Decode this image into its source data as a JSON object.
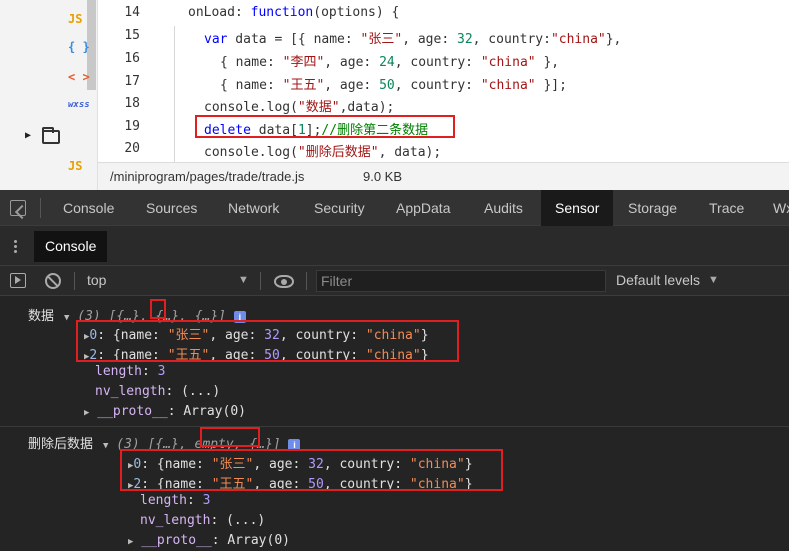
{
  "file_tree": {
    "items": [
      {
        "badge": "JS"
      },
      {
        "badge": "{ }"
      },
      {
        "badge": "< >"
      },
      {
        "badge": "wxss"
      },
      {
        "badge": "folder"
      },
      {
        "badge": "JS"
      }
    ]
  },
  "editor": {
    "line_numbers": [
      "14",
      "15",
      "16",
      "17",
      "18",
      "19",
      "20"
    ],
    "lines": {
      "l14": {
        "a": "onLoad: ",
        "b": "function",
        "c": "(options) {"
      },
      "l15": {
        "a": "var",
        "b": " data = [{ name: ",
        "c": "\"张三\"",
        "d": ", age: ",
        "e": "32",
        "f": ", country:",
        "g": "\"china\"",
        "h": "},"
      },
      "l16": {
        "a": "{ name: ",
        "b": "\"李四\"",
        "c": ", age: ",
        "d": "24",
        "e": ", country: ",
        "f": "\"china\"",
        "g": " },"
      },
      "l17": {
        "a": "{ name: ",
        "b": "\"王五\"",
        "c": ", age: ",
        "d": "50",
        "e": ", country: ",
        "f": "\"china\"",
        "g": " }];"
      },
      "l18": {
        "a": "console.log(",
        "b": "\"数据\"",
        "c": ",data);"
      },
      "l19": {
        "a": "delete",
        "b": " data[",
        "c": "1",
        "d": "];",
        "e": "//删除第二条数据"
      },
      "l20": {
        "a": "console.log(",
        "b": "\"删除后数据\"",
        "c": ", data);"
      }
    },
    "status_path": "/miniprogram/pages/trade/trade.js",
    "status_size": "9.0 KB"
  },
  "devtools": {
    "tabs": [
      "Console",
      "Sources",
      "Network",
      "Security",
      "AppData",
      "Audits",
      "Sensor",
      "Storage",
      "Trace",
      "Wx"
    ],
    "active_tab": "Sensor",
    "drawer_tab": "Console",
    "context": "top",
    "filter_placeholder": "Filter",
    "levels": "Default levels"
  },
  "console": {
    "log1": {
      "label": "数据",
      "summary": {
        "count": "(3)",
        "open": " [",
        "i0": "{…}",
        "comma1": ", ",
        "i1": "{…}",
        "comma2": ", ",
        "i2": "{…}",
        "close": "]"
      },
      "item0": {
        "idx": "0",
        "pre": ": {name: ",
        "name": "\"张三\"",
        "age_k": ", age: ",
        "age": "32",
        "country_k": ", country: ",
        "country": "\"china\"",
        "end": "}"
      },
      "item2": {
        "idx": "2",
        "pre": ": {name: ",
        "name": "\"王五\"",
        "age_k": ", age: ",
        "age": "50",
        "country_k": ", country: ",
        "country": "\"china\"",
        "end": "}"
      },
      "length_k": "length",
      "length_v": "3",
      "nv_k": "nv_length",
      "nv_v": "(...)",
      "proto_k": "__proto__",
      "proto_v": "Array(0)"
    },
    "log2": {
      "label": "删除后数据",
      "summary": {
        "count": "(3)",
        "open": " [",
        "i0": "{…}",
        "comma1": ", ",
        "i1": "empty",
        "comma2": ", ",
        "i2": "{…}",
        "close": "]"
      },
      "item0": {
        "idx": "0",
        "pre": ": {name: ",
        "name": "\"张三\"",
        "age_k": ", age: ",
        "age": "32",
        "country_k": ", country: ",
        "country": "\"china\"",
        "end": "}"
      },
      "item2": {
        "idx": "2",
        "pre": ": {name: ",
        "name": "\"王五\"",
        "age_k": ", age: ",
        "age": "50",
        "country_k": ", country: ",
        "country": "\"china\"",
        "end": "}"
      },
      "length_k": "length",
      "length_v": "3",
      "nv_k": "nv_length",
      "nv_v": "(...)",
      "proto_k": "__proto__",
      "proto_v": "Array(0)"
    },
    "info_badge": "i",
    "colon": ": "
  },
  "colors": {
    "highlight": "#e02020",
    "console_bg": "#242424",
    "tab_bar_bg": "#333333",
    "string": "#f28b54",
    "number": "#b399ff",
    "keyword": "#0000ff"
  }
}
